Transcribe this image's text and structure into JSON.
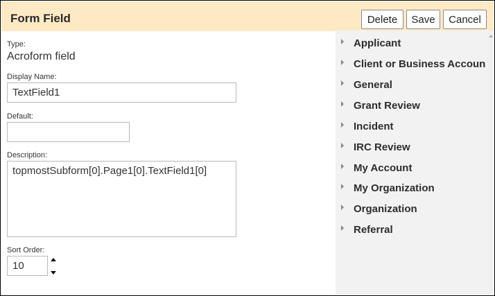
{
  "header": {
    "title": "Form Field",
    "delete_label": "Delete",
    "save_label": "Save",
    "cancel_label": "Cancel"
  },
  "form": {
    "type_label": "Type:",
    "type_value": "Acroform field",
    "display_name_label": "Display Name:",
    "display_name_value": "TextField1",
    "default_label": "Default:",
    "default_value": "",
    "description_label": "Description:",
    "description_value": "topmostSubform[0].Page1[0].TextField1[0]",
    "sort_order_label": "Sort Order:",
    "sort_order_value": "10"
  },
  "categories": [
    {
      "label": "Applicant"
    },
    {
      "label": "Client or Business Accoun"
    },
    {
      "label": "General"
    },
    {
      "label": "Grant Review"
    },
    {
      "label": "Incident"
    },
    {
      "label": "IRC Review"
    },
    {
      "label": "My Account"
    },
    {
      "label": "My Organization"
    },
    {
      "label": "Organization"
    },
    {
      "label": "Referral"
    }
  ]
}
